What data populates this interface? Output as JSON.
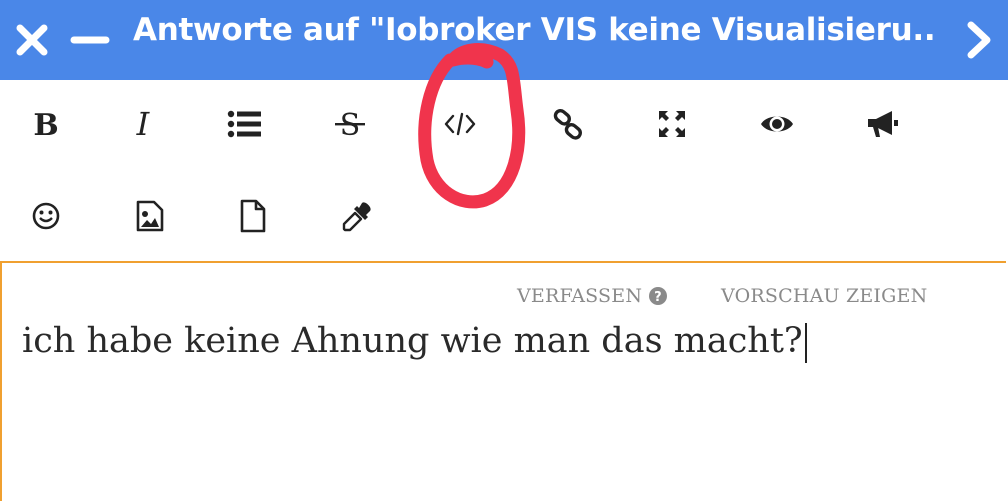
{
  "header": {
    "title": "Antworte auf \"Iobroker VIS keine Visualisieru...",
    "close_icon": "close-icon",
    "minimize_icon": "minimize-icon",
    "next_icon": "chevron-right-icon",
    "background": "#4a87e8"
  },
  "toolbar": {
    "items": [
      {
        "name": "bold",
        "icon": "bold-icon"
      },
      {
        "name": "italic",
        "icon": "italic-icon"
      },
      {
        "name": "bullet-list",
        "icon": "list-icon"
      },
      {
        "name": "strikethrough",
        "icon": "strikethrough-icon"
      },
      {
        "name": "code",
        "icon": "code-icon"
      },
      {
        "name": "link",
        "icon": "link-icon"
      },
      {
        "name": "fullscreen",
        "icon": "expand-icon"
      },
      {
        "name": "spoiler",
        "icon": "eye-icon"
      },
      {
        "name": "announcement",
        "icon": "bullhorn-icon"
      },
      {
        "name": "emoji",
        "icon": "smile-icon"
      },
      {
        "name": "image",
        "icon": "image-icon"
      },
      {
        "name": "file",
        "icon": "file-icon"
      },
      {
        "name": "color",
        "icon": "eyedropper-icon"
      }
    ]
  },
  "editor": {
    "tabs": {
      "compose": "VERFASSEN",
      "preview": "VORSCHAU ZEIGEN"
    },
    "content": "ich habe keine Ahnung wie man das macht?",
    "border_color": "#f0a030"
  },
  "annotation": {
    "shape": "hand-drawn circle",
    "color": "#f0344c"
  }
}
